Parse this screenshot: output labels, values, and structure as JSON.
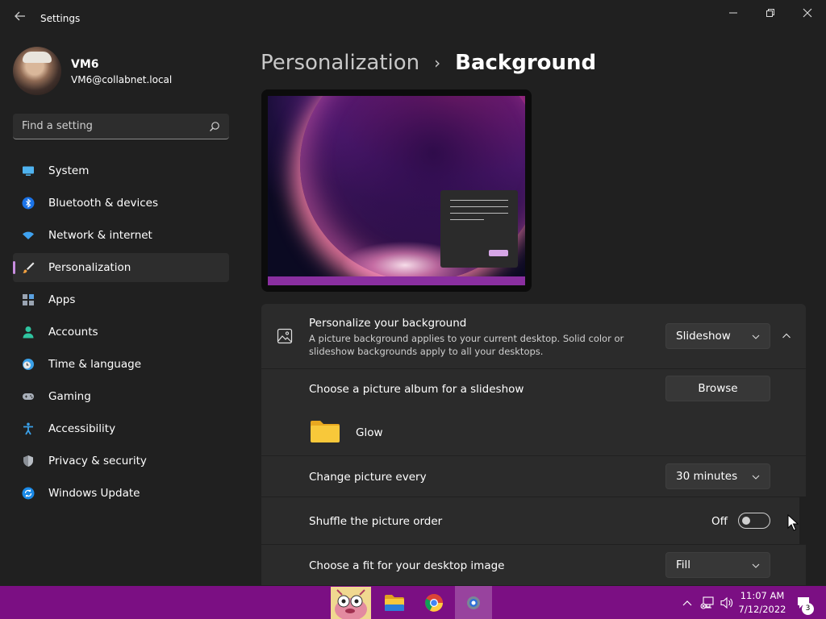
{
  "window": {
    "title": "Settings",
    "controls": {
      "minimize": "minimize",
      "maximize": "restore",
      "close": "close"
    }
  },
  "profile": {
    "name": "VM6",
    "email": "VM6@collabnet.local"
  },
  "search": {
    "placeholder": "Find a setting"
  },
  "nav": {
    "items": [
      {
        "label": "System",
        "icon": "monitor-icon"
      },
      {
        "label": "Bluetooth & devices",
        "icon": "bluetooth-icon"
      },
      {
        "label": "Network & internet",
        "icon": "wifi-icon"
      },
      {
        "label": "Personalization",
        "icon": "paintbrush-icon",
        "active": true
      },
      {
        "label": "Apps",
        "icon": "apps-icon"
      },
      {
        "label": "Accounts",
        "icon": "person-icon"
      },
      {
        "label": "Time & language",
        "icon": "clock-globe-icon"
      },
      {
        "label": "Gaming",
        "icon": "gamepad-icon"
      },
      {
        "label": "Accessibility",
        "icon": "accessibility-icon"
      },
      {
        "label": "Privacy & security",
        "icon": "shield-icon"
      },
      {
        "label": "Windows Update",
        "icon": "update-icon"
      }
    ]
  },
  "breadcrumb": {
    "parent": "Personalization",
    "separator": "›",
    "current": "Background"
  },
  "background": {
    "personalize": {
      "title": "Personalize your background",
      "description": "A picture background applies to your current desktop. Solid color or slideshow backgrounds apply to all your desktops.",
      "value": "Slideshow"
    },
    "album": {
      "label": "Choose a picture album for a slideshow",
      "browse_label": "Browse",
      "folder_name": "Glow"
    },
    "change": {
      "label": "Change picture every",
      "value": "30 minutes"
    },
    "shuffle": {
      "label": "Shuffle the picture order",
      "state_label": "Off",
      "on": false
    },
    "fit": {
      "label": "Choose a fit for your desktop image",
      "value": "Fill"
    }
  },
  "taskbar": {
    "apps": [
      "widgets-icon",
      "file-explorer-icon",
      "chrome-icon",
      "settings-icon"
    ],
    "clock": {
      "time": "11:07 AM",
      "date": "7/12/2022"
    },
    "notification_count": "3"
  },
  "colors": {
    "accent": "#c88ee0",
    "taskbar": "#7b0f83",
    "panel": "#2b2b2b",
    "background": "#202020"
  }
}
